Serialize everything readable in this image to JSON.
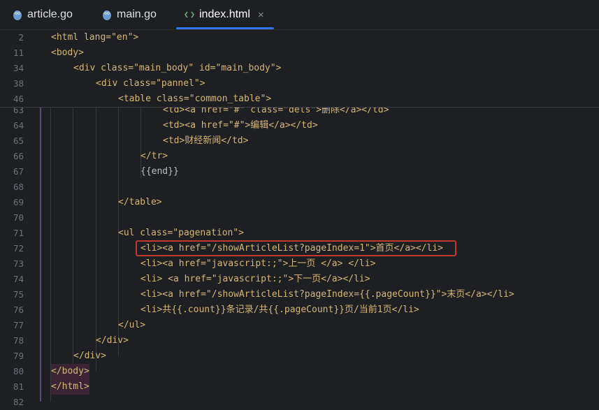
{
  "tabs": [
    {
      "label": "article.go",
      "icon": "gopher-icon"
    },
    {
      "label": "main.go",
      "icon": "gopher-icon"
    },
    {
      "label": "index.html",
      "icon": "html-brackets-icon",
      "active": true,
      "close": "×"
    }
  ],
  "sticky_lines": [
    {
      "num": "2",
      "text": "<html lang=\"en\">"
    },
    {
      "num": "11",
      "text": "<body>"
    },
    {
      "num": "34",
      "text": "<div class=\"main_body\" id=\"main_body\">"
    },
    {
      "num": "38",
      "text": "<div class=\"pannel\">"
    },
    {
      "num": "46",
      "text": "<table class=\"common_table\">"
    }
  ],
  "lines": [
    {
      "num": "63",
      "text": "<td><a href=\"#\" class=\"dels\">删除</a></td>"
    },
    {
      "num": "64",
      "text": "<td><a href=\"#\">编辑</a></td>"
    },
    {
      "num": "65",
      "text": "<td>财经新闻</td>"
    },
    {
      "num": "66",
      "text": "</tr>"
    },
    {
      "num": "67",
      "text": "{{end}}"
    },
    {
      "num": "68",
      "text": ""
    },
    {
      "num": "69",
      "text": "</table>"
    },
    {
      "num": "70",
      "text": ""
    },
    {
      "num": "71",
      "text": "<ul class=\"pagenation\">"
    },
    {
      "num": "72",
      "text": "<li><a href=\"/showArticleList?pageIndex=1\">首页</a></li>"
    },
    {
      "num": "73",
      "text": "<li><a href=\"javascript:;\">上一页 </a> </li>"
    },
    {
      "num": "74",
      "text": "<li> <a href=\"javascript:;\">下一页</a></li>"
    },
    {
      "num": "75",
      "text": "<li><a href=\"/showArticleList?pageIndex={{.pageCount}}\">末页</a></li>"
    },
    {
      "num": "76",
      "text": "<li>共{{.count}}条记录/共{{.pageCount}}页/当前1页</li>"
    },
    {
      "num": "77",
      "text": "</ul>"
    },
    {
      "num": "78",
      "text": "</div>"
    },
    {
      "num": "79",
      "text": "</div>"
    },
    {
      "num": "80",
      "text": "</body>"
    },
    {
      "num": "81",
      "text": "</html>"
    },
    {
      "num": "82",
      "text": ""
    }
  ],
  "colors": {
    "accent": "#3574f0",
    "tag": "#d5b778",
    "string": "#6aab73",
    "highlight_box": "#c0392b"
  }
}
